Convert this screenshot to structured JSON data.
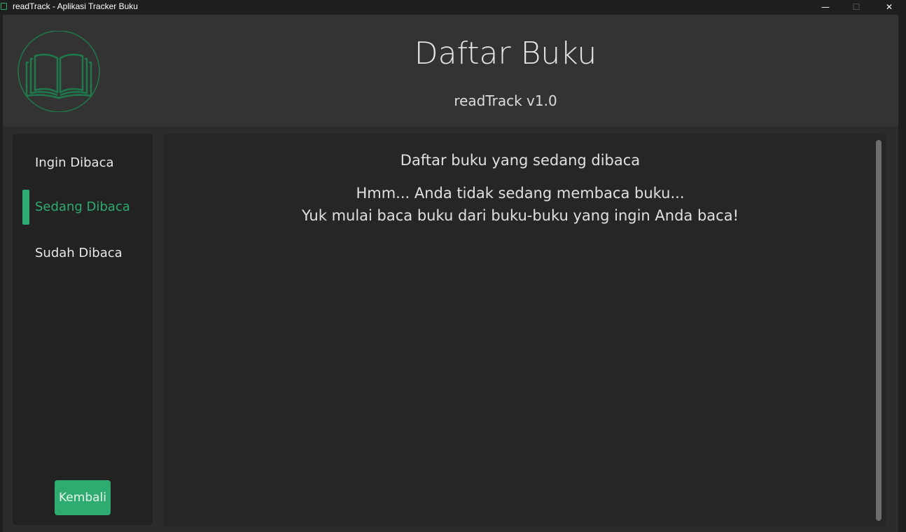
{
  "window": {
    "title": "readTrack - Aplikasi Tracker Buku",
    "controls": {
      "minimize": "—",
      "maximize": "☐",
      "close": "✕"
    }
  },
  "header": {
    "logo_icon": "open-book-icon",
    "title": "Daftar Buku",
    "subtitle": "readTrack v1.0"
  },
  "sidebar": {
    "items": [
      {
        "label": "Ingin Dibaca",
        "active": false
      },
      {
        "label": "Sedang Dibaca",
        "active": true
      },
      {
        "label": "Sudah Dibaca",
        "active": false
      }
    ],
    "back_label": "Kembali"
  },
  "content": {
    "heading": "Daftar buku yang sedang dibaca",
    "empty_line_1": "Hmm... Anda tidak sedang membaca buku...",
    "empty_line_2": "Yuk mulai baca buku dari buku-buku yang ingin Anda baca!"
  },
  "colors": {
    "accent": "#2eab70",
    "header_bg": "#333333",
    "panel_bg": "#222222",
    "content_bg": "#262626"
  }
}
